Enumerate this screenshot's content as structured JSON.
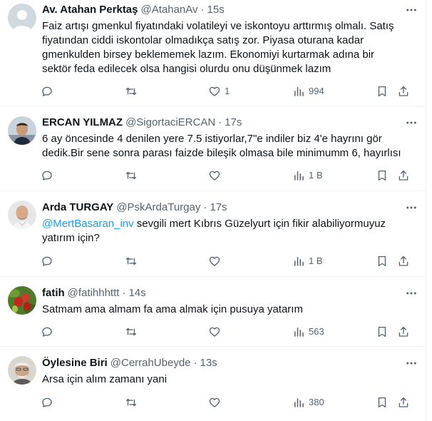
{
  "colors": {
    "text_primary": "#0f1419",
    "text_secondary": "#536471",
    "mention": "#1d9bf0",
    "divider": "#eff3f4"
  },
  "tweets": [
    {
      "author": "Av. Atahan Perktaş",
      "handle": "@AtahanAv",
      "time": "15s",
      "text_lines": [
        "Faiz artışı gmenkul fiyatındaki volatileyi ve iskontoyu arttırmış olmalı. Satış",
        "fiyatından ciddi iskontolar olmadıkça satış zor. Piyasa oturana kadar",
        "gmenkulden birsey beklememek lazım. Ekonomiyi kurtarmak adına bir",
        "sektör feda edilecek olsa hangisi olurdu onu düşünmek lazım"
      ],
      "likes": "1",
      "views": "994",
      "avatar_icon": "default-avatar"
    },
    {
      "author": "ERCAN YILMAZ",
      "handle": "@SigortaciERCAN",
      "time": "17s",
      "text_lines": [
        "6 ay öncesinde 4 denilen yere 7.5 istiyorlar,7\"e indiler biz 4'e hayrını gör",
        "dedik.Bir sene sonra parası faizde bileşik olmasa bile minimumm 6, hayırlısı"
      ],
      "views": "1 B",
      "avatar_icon": "man-photo-avatar"
    },
    {
      "author": "Arda TURGAY",
      "handle": "@PskArdaTurgay",
      "time": "17s",
      "mention": "@MertBasaran_inv",
      "text_lines": [
        " sevgili mert Kıbrıs Güzelyurt için fikir alabiliyormuyuz",
        "yatırım için?"
      ],
      "views": "1 B",
      "avatar_icon": "bald-man-photo-avatar"
    },
    {
      "author": "fatih",
      "handle": "@fatihhhttt",
      "time": "14s",
      "text_lines": [
        "Satmam ama almam fa ama almak için pusuya yatarım"
      ],
      "views": "563",
      "avatar_icon": "strawberries-photo-avatar"
    },
    {
      "author": "Öylesine Biri",
      "handle": "@CerrahUbeyde",
      "time": "13s",
      "text_lines": [
        "Arsa için alım zamanı yani"
      ],
      "views": "380",
      "avatar_icon": "elderly-man-photo-avatar"
    }
  ],
  "header_separator": "·"
}
